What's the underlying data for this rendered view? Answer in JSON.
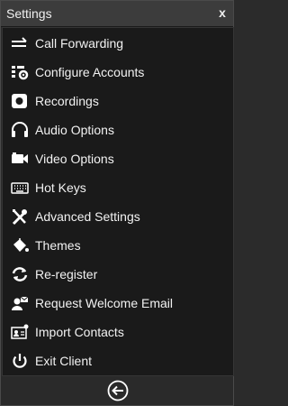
{
  "window": {
    "title": "Settings",
    "close_label": "x"
  },
  "menu": {
    "items": [
      {
        "label": "Call Forwarding",
        "icon": "call-forward-icon"
      },
      {
        "label": "Configure Accounts",
        "icon": "configure-accounts-icon"
      },
      {
        "label": "Recordings",
        "icon": "record-icon"
      },
      {
        "label": "Audio Options",
        "icon": "headphones-icon"
      },
      {
        "label": "Video Options",
        "icon": "video-camera-icon"
      },
      {
        "label": "Hot Keys",
        "icon": "keyboard-icon"
      },
      {
        "label": "Advanced Settings",
        "icon": "tools-icon"
      },
      {
        "label": "Themes",
        "icon": "paint-bucket-icon"
      },
      {
        "label": "Re-register",
        "icon": "refresh-icon"
      },
      {
        "label": "Request Welcome Email",
        "icon": "user-mail-icon"
      },
      {
        "label": "Import Contacts",
        "icon": "contact-card-icon"
      },
      {
        "label": "Exit Client",
        "icon": "power-icon"
      }
    ]
  },
  "footer": {
    "back_icon": "back-arrow-icon"
  },
  "colors": {
    "text": "#f2f2f2",
    "panel": "#1a1a1a",
    "titlebar": "#3c3c3c"
  }
}
